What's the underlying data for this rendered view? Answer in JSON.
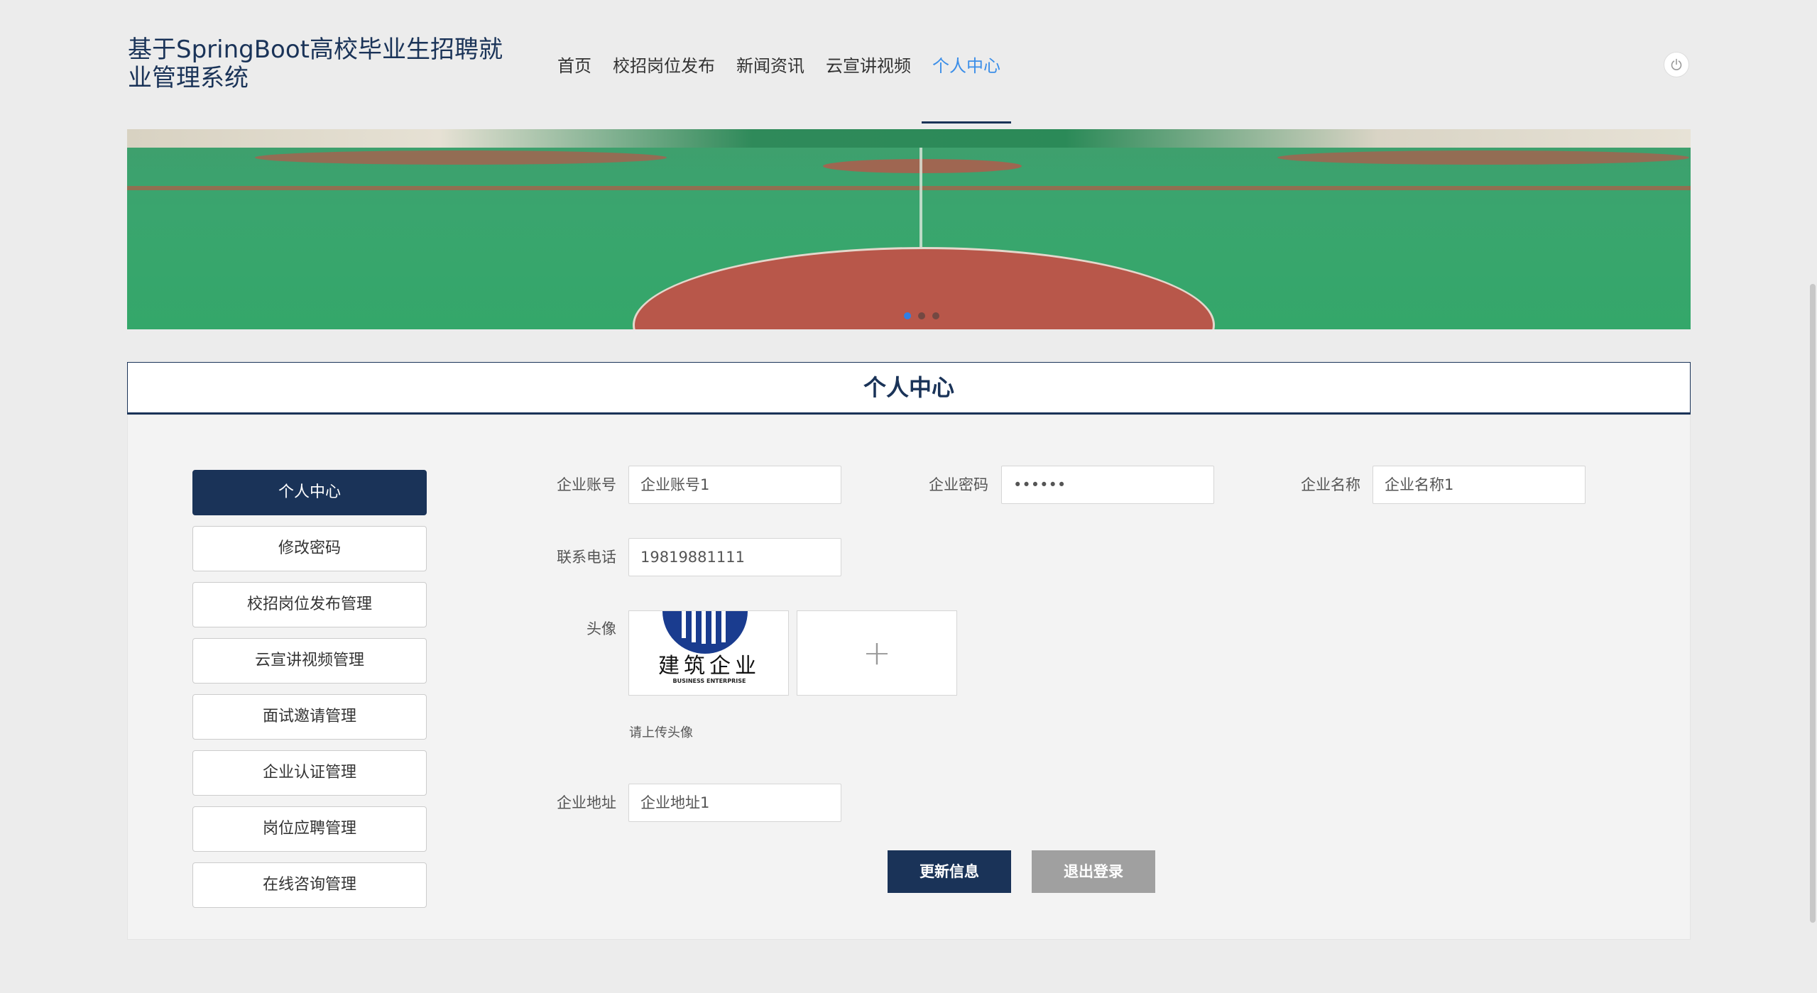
{
  "header": {
    "title": "基于SpringBoot高校毕业生招聘就业管理系统",
    "nav": [
      {
        "label": "首页",
        "active": false
      },
      {
        "label": "校招岗位发布",
        "active": false
      },
      {
        "label": "新闻资讯",
        "active": false
      },
      {
        "label": "云宣讲视频",
        "active": false
      },
      {
        "label": "个人中心",
        "active": true
      }
    ],
    "power_icon": "power-icon"
  },
  "banner": {
    "slide_count": 3,
    "active_slide": 1
  },
  "section": {
    "title": "个人中心"
  },
  "menu": {
    "items": [
      {
        "label": "个人中心",
        "active": true
      },
      {
        "label": "修改密码",
        "active": false
      },
      {
        "label": "校招岗位发布管理",
        "active": false
      },
      {
        "label": "云宣讲视频管理",
        "active": false
      },
      {
        "label": "面试邀请管理",
        "active": false
      },
      {
        "label": "企业认证管理",
        "active": false
      },
      {
        "label": "岗位应聘管理",
        "active": false
      },
      {
        "label": "在线咨询管理",
        "active": false
      }
    ]
  },
  "form": {
    "account_label": "企业账号",
    "account_value": "企业账号1",
    "password_label": "企业密码",
    "password_value": "••••••",
    "name_label": "企业名称",
    "name_value": "企业名称1",
    "phone_label": "联系电话",
    "phone_value": "19819881111",
    "avatar_label": "头像",
    "avatar_logo_text": "建筑企业",
    "avatar_logo_subtext": "BUSINESS ENTERPRISE",
    "avatar_hint": "请上传头像",
    "address_label": "企业地址",
    "address_value": "企业地址1"
  },
  "buttons": {
    "update": "更新信息",
    "logout": "退出登录"
  },
  "colors": {
    "primary": "#1a3358",
    "nav_active": "#3b8ee8",
    "gray_button": "#a0a0a0"
  }
}
